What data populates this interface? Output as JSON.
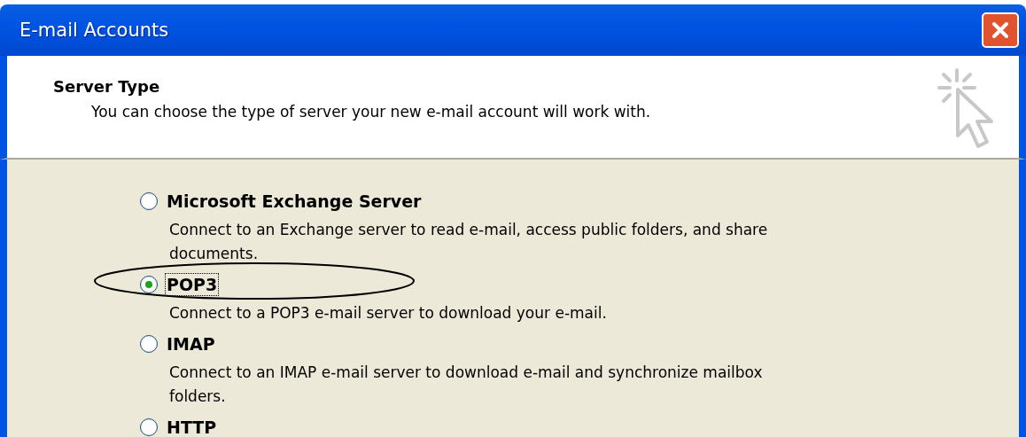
{
  "window": {
    "title": "E-mail Accounts"
  },
  "header": {
    "title": "Server Type",
    "subtitle": "You can choose the type of server your new e-mail account will work with."
  },
  "options": [
    {
      "label": "Microsoft Exchange Server",
      "selected": false,
      "description": "Connect to an Exchange server to read e-mail, access public folders, and share documents."
    },
    {
      "label": "POP3",
      "selected": true,
      "description": "Connect to a POP3 e-mail server to download your e-mail."
    },
    {
      "label": "IMAP",
      "selected": false,
      "description": "Connect to an IMAP e-mail server to download e-mail and synchronize mailbox folders."
    },
    {
      "label": "HTTP",
      "selected": false
    }
  ]
}
